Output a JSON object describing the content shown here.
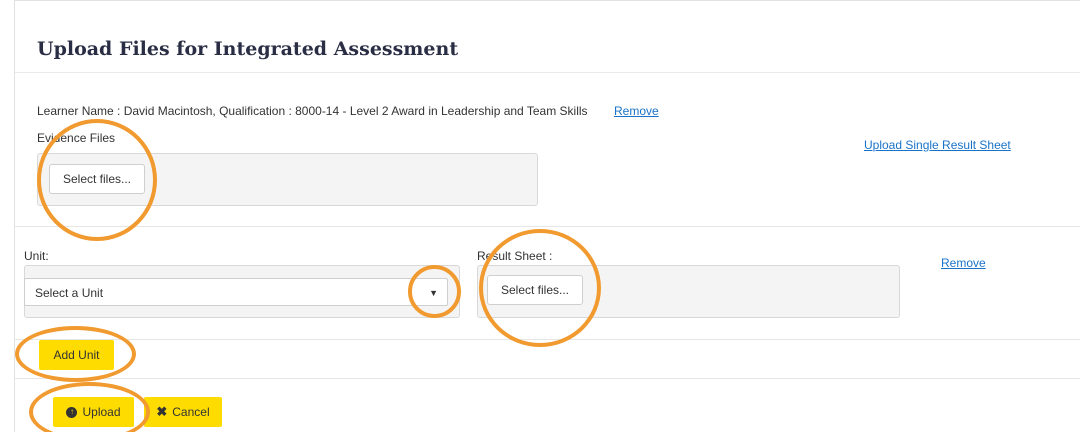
{
  "page": {
    "title": "Upload Files for Integrated Assessment"
  },
  "learner": {
    "text": "Learner Name : David Macintosh, Qualification : 8000-14 - Level 2 Award in Leadership and Team Skills",
    "remove_label": "Remove"
  },
  "evidence": {
    "label": "Evidence Files",
    "select_files_label": "Select files...",
    "upload_single_label": "Upload Single Result Sheet"
  },
  "unit_row": {
    "unit_label": "Unit:",
    "unit_select_value": "Select a Unit",
    "arrow_glyph": "▼",
    "result_label": "Result Sheet :",
    "result_select_files_label": "Select files...",
    "remove_label": "Remove"
  },
  "actions": {
    "add_unit_label": "Add Unit",
    "upload_label": "Upload",
    "upload_icon_glyph": "↑",
    "cancel_label": "Cancel",
    "cancel_icon_glyph": "✖"
  },
  "colors": {
    "accent_yellow": "#ffdc00",
    "highlight_orange": "#f19a2f",
    "link_blue": "#1a73c9",
    "title_navy": "#2a2e45"
  }
}
